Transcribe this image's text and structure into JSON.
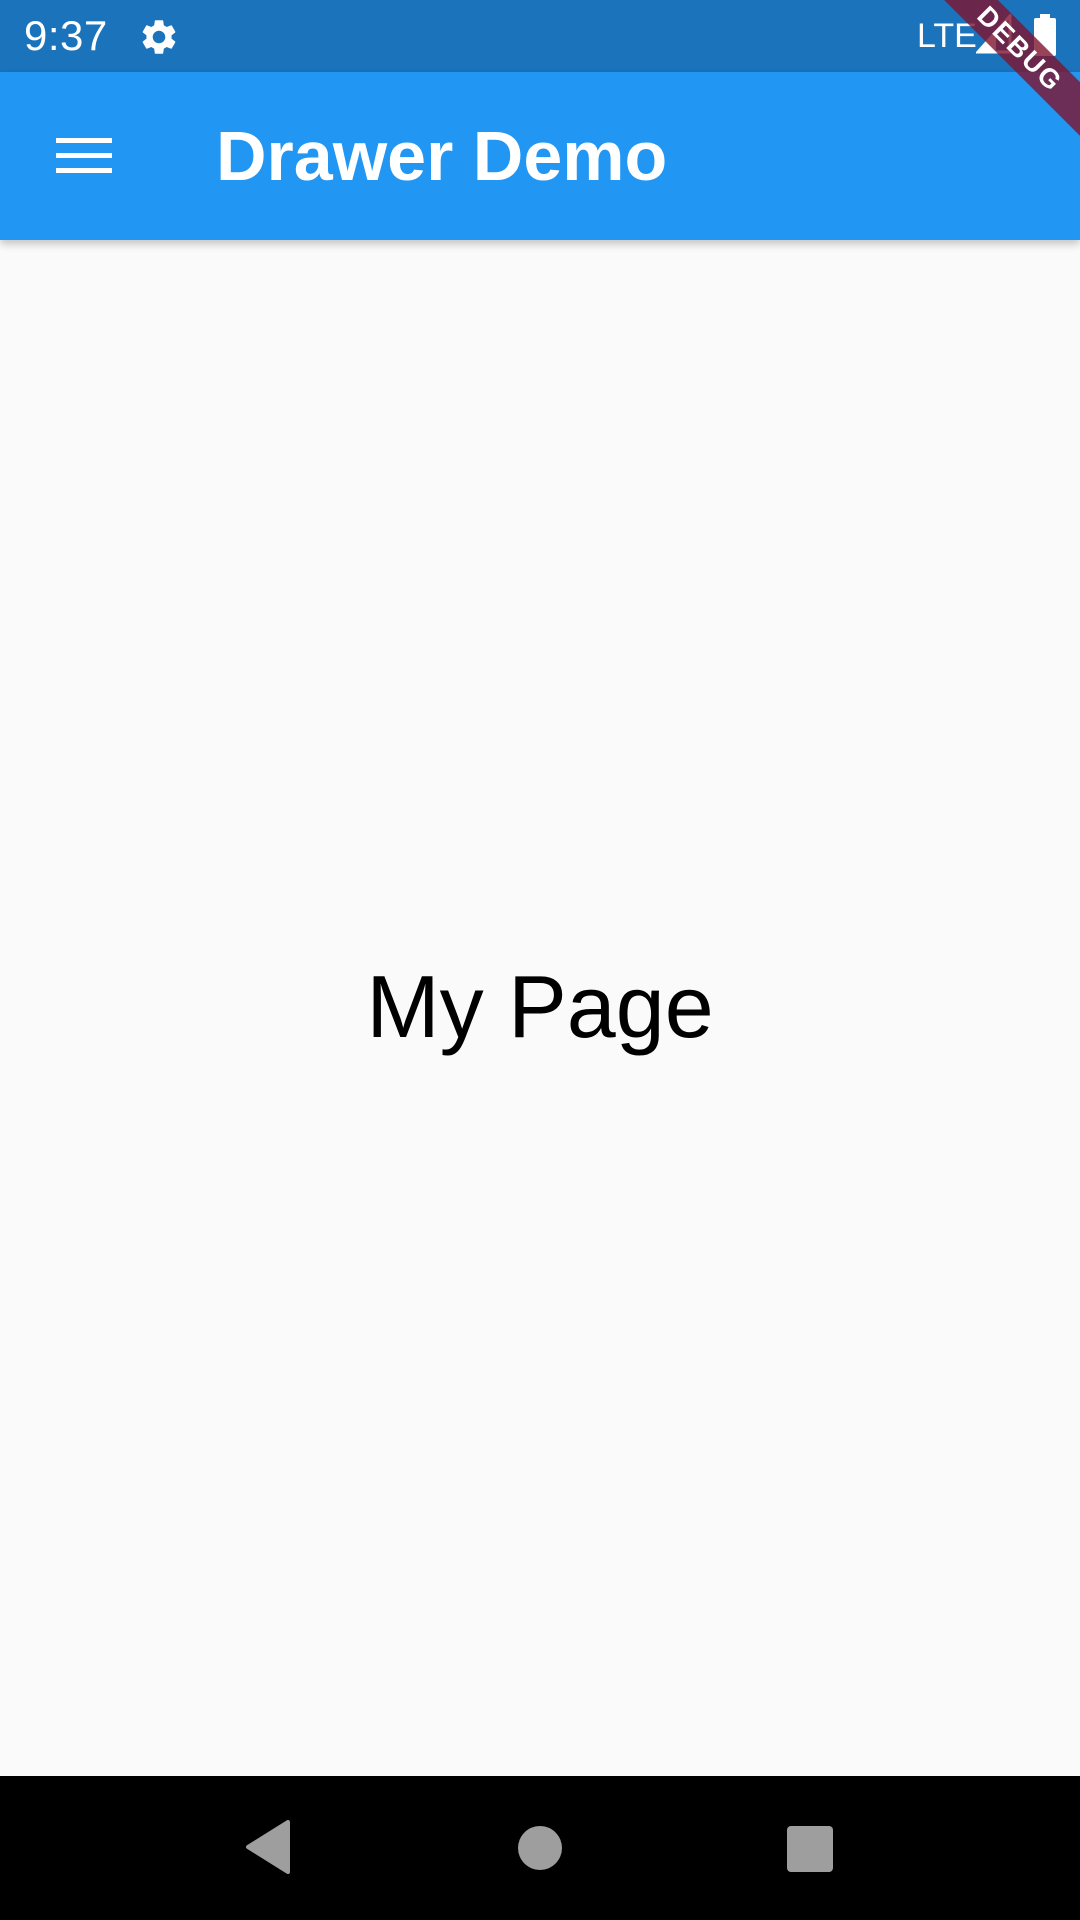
{
  "status_bar": {
    "time": "9:37",
    "network": "LTE",
    "icons": [
      "gear-icon",
      "signal-icon",
      "battery-icon"
    ],
    "color": "#1a73bb"
  },
  "app_bar": {
    "title": "Drawer Demo",
    "menu_icon": "hamburger-menu-icon",
    "color": "#2196f3"
  },
  "debug_banner": {
    "label": "DEBUG",
    "color": "#801430"
  },
  "main": {
    "text": "My Page",
    "background": "#fafafa"
  },
  "nav_bar": {
    "buttons": [
      "back-icon",
      "home-icon",
      "recents-icon"
    ],
    "color": "#000000"
  }
}
